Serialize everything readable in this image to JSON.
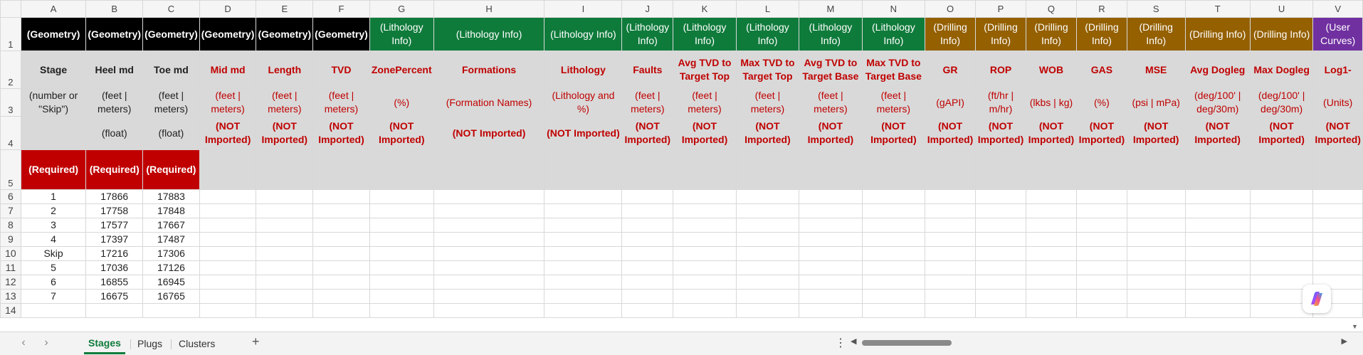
{
  "columns": [
    "A",
    "B",
    "C",
    "D",
    "E",
    "F",
    "G",
    "H",
    "I",
    "J",
    "K",
    "L",
    "M",
    "N",
    "O",
    "P",
    "Q",
    "R",
    "S",
    "T",
    "U",
    "V"
  ],
  "row_numbers": [
    "1",
    "2",
    "3",
    "4",
    "5",
    "6",
    "7",
    "8",
    "9",
    "10",
    "11",
    "12",
    "13",
    "14"
  ],
  "categories": [
    "(Geometry)",
    "(Geometry)",
    "(Geometry)",
    "(Geometry)",
    "(Geometry)",
    "(Geometry)",
    "(Lithology Info)",
    "(Lithology Info)",
    "(Lithology Info)",
    "(Lithology Info)",
    "(Lithology Info)",
    "(Lithology Info)",
    "(Lithology Info)",
    "(Lithology Info)",
    "(Drilling Info)",
    "(Drilling Info)",
    "(Drilling Info)",
    "(Drilling Info)",
    "(Drilling Info)",
    "(Drilling Info)",
    "(Drilling Info)",
    "(User Curves)"
  ],
  "names": [
    "Stage",
    "Heel md",
    "Toe md",
    "Mid md",
    "Length",
    "TVD",
    "ZonePercent",
    "Formations",
    "Lithology",
    "Faults",
    "Avg TVD to Target Top",
    "Max TVD to Target Top",
    "Avg TVD to Target Base",
    "Max TVD to Target Base",
    "GR",
    "ROP",
    "WOB",
    "GAS",
    "MSE",
    "Avg Dogleg",
    "Max Dogleg",
    "Log1-"
  ],
  "units": [
    "(number or \"Skip\")",
    "(feet | meters)",
    "(feet | meters)",
    "(feet | meters)",
    "(feet | meters)",
    "(feet | meters)",
    "(%)",
    "(Formation Names)",
    "(Lithology and %)",
    "(feet | meters)",
    "(feet | meters)",
    "(feet | meters)",
    "(feet | meters)",
    "(feet | meters)",
    "(gAPI)",
    "(ft/hr | m/hr)",
    "(lkbs | kg)",
    "(%)",
    "(psi | mPa)",
    "(deg/100' | deg/30m)",
    "(deg/100' | deg/30m)",
    "(Units)"
  ],
  "types": [
    "",
    "(float)",
    "(float)",
    "(NOT Imported)",
    "(NOT Imported)",
    "(NOT Imported)",
    "(NOT Imported)",
    "(NOT Imported)",
    "(NOT Imported)",
    "(NOT Imported)",
    "(NOT Imported)",
    "(NOT Imported)",
    "(NOT Imported)",
    "(NOT Imported)",
    "(NOT Imported)",
    "(NOT Imported)",
    "(NOT Imported)",
    "(NOT Imported)",
    "(NOT Imported)",
    "(NOT Imported)",
    "(NOT Imported)",
    "(NOT Imported)"
  ],
  "required": [
    "(Required)",
    "(Required)",
    "(Required)"
  ],
  "data_rows": [
    [
      "1",
      "17866",
      "17883"
    ],
    [
      "2",
      "17758",
      "17848"
    ],
    [
      "3",
      "17577",
      "17667"
    ],
    [
      "4",
      "17397",
      "17487"
    ],
    [
      "Skip",
      "17216",
      "17306"
    ],
    [
      "5",
      "17036",
      "17126"
    ],
    [
      "6",
      "16855",
      "16945"
    ],
    [
      "7",
      "16675",
      "16765"
    ]
  ],
  "sheet_tabs": [
    {
      "label": "Stages",
      "active": true
    },
    {
      "label": "Plugs",
      "active": false
    },
    {
      "label": "Clusters",
      "active": false
    }
  ],
  "bottombar": {
    "add_tab": "+",
    "more": "⋮",
    "prev": "‹",
    "next": "›",
    "scroll_left": "◀",
    "scroll_right": "▶"
  },
  "colors": {
    "geometry": "#000000",
    "lithology": "#0f7b3b",
    "drilling": "#946000",
    "user_curves": "#7030a0",
    "required": "#c00000",
    "header_gray": "#d9d9d9",
    "not_imported_text": "#c00000"
  },
  "icons": {
    "copilot": "copilot-icon",
    "scroll_down": "scroll-down-arrow-icon"
  }
}
